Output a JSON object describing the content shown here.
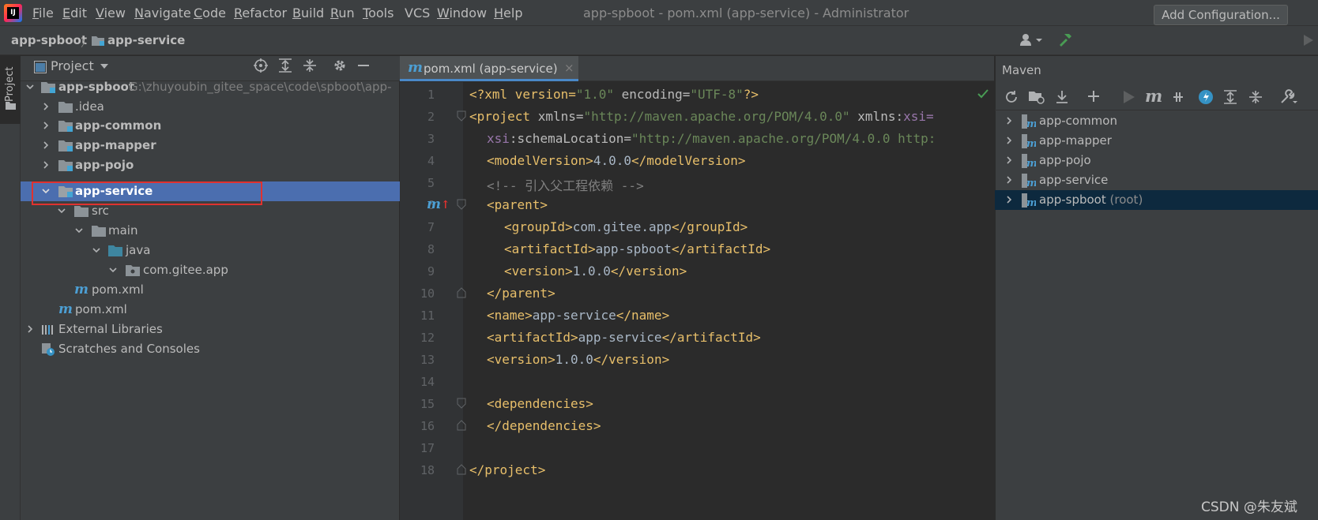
{
  "menubar": {
    "items": [
      {
        "label": "File",
        "mnemonic": "F",
        "rest": "ile"
      },
      {
        "label": "Edit",
        "mnemonic": "E",
        "rest": "dit"
      },
      {
        "label": "View",
        "mnemonic": "V",
        "rest": "iew"
      },
      {
        "label": "Navigate",
        "mnemonic": "N",
        "rest": "avigate"
      },
      {
        "label": "Code",
        "mnemonic": "C",
        "rest": "ode"
      },
      {
        "label": "Refactor",
        "mnemonic": "R",
        "rest": "efactor"
      },
      {
        "label": "Build",
        "mnemonic": "B",
        "rest": "uild"
      },
      {
        "label": "Run",
        "mnemonic": "R",
        "rest": "un"
      },
      {
        "label": "Tools",
        "mnemonic": "T",
        "rest": "ools"
      },
      {
        "label": "VCS",
        "mnemonic": "",
        "rest": "VCS"
      },
      {
        "label": "Window",
        "mnemonic": "W",
        "rest": "indow"
      },
      {
        "label": "Help",
        "mnemonic": "H",
        "rest": "elp"
      }
    ],
    "window_title": "app-spboot - pom.xml (app-service) - Administrator"
  },
  "navbar": {
    "breadcrumb": [
      "app-spboot",
      "app-service"
    ],
    "add_config_label": "Add Configuration..."
  },
  "left_strip": {
    "project_tab": "Project"
  },
  "project": {
    "title": "Project",
    "tree": [
      {
        "label": "app-spboot",
        "extra": "G:\\zhuyoubin_gitee_space\\code\\spboot\\app-",
        "bold": true,
        "expanded": true
      },
      {
        "label": ".idea",
        "bold": false,
        "expanded": false
      },
      {
        "label": "app-common",
        "bold": true,
        "expanded": false
      },
      {
        "label": "app-mapper",
        "bold": true,
        "expanded": false
      },
      {
        "label": "app-pojo",
        "bold": true,
        "expanded": false
      },
      {
        "label": "app-service",
        "bold": true,
        "expanded": true,
        "selected": true
      },
      {
        "label": "src",
        "bold": false,
        "expanded": true
      },
      {
        "label": "main",
        "bold": false,
        "expanded": true
      },
      {
        "label": "java",
        "bold": false,
        "expanded": true
      },
      {
        "label": "com.gitee.app",
        "bold": false,
        "expanded": true
      },
      {
        "label": "pom.xml",
        "bold": false
      },
      {
        "label": "pom.xml",
        "bold": false
      },
      {
        "label": "External Libraries",
        "bold": false,
        "expanded": false
      },
      {
        "label": "Scratches and Consoles",
        "bold": false
      }
    ]
  },
  "editor": {
    "tab_label": "pom.xml (app-service)",
    "line_numbers": [
      "1",
      "2",
      "3",
      "4",
      "5",
      "6",
      "7",
      "8",
      "9",
      "10",
      "11",
      "12",
      "13",
      "14",
      "15",
      "16",
      "17",
      "18"
    ],
    "lines": {
      "l1": {
        "p1": "<?xml version=",
        "p2": "\"1.0\"",
        "p3": " encoding=",
        "p4": "\"UTF-8\"",
        "p5": "?>"
      },
      "l2": {
        "p1": "<project",
        "p2": " xmlns=",
        "p3": "\"http://maven.apache.org/POM/4.0.0\"",
        "p4": " xmlns:",
        "p5": "xsi="
      },
      "l3": {
        "p1": "xsi",
        "p2": ":schemaLocation=",
        "p3": "\"http://maven.apache.org/POM/4.0.0 http:"
      },
      "l4": {
        "p1": "<modelVersion>",
        "p2": "4.0.0",
        "p3": "</modelVersion>"
      },
      "l5": {
        "p1": "<!-- 引入父工程依赖 -->"
      },
      "l6": {
        "p1": "<parent>"
      },
      "l7": {
        "p1": "<groupId>",
        "p2": "com.gitee.app",
        "p3": "</groupId>"
      },
      "l8": {
        "p1": "<artifactId>",
        "p2": "app-spboot",
        "p3": "</artifactId>"
      },
      "l9": {
        "p1": "<version>",
        "p2": "1.0.0",
        "p3": "</version>"
      },
      "l10": {
        "p1": "</parent>"
      },
      "l11": {
        "p1": "<name>",
        "p2": "app-service",
        "p3": "</name>"
      },
      "l12": {
        "p1": "<artifactId>",
        "p2": "app-service",
        "p3": "</artifactId>"
      },
      "l13": {
        "p1": "<version>",
        "p2": "1.0.0",
        "p3": "</version>"
      },
      "l15": {
        "p1": "<dependencies>"
      },
      "l16": {
        "p1": "</dependencies>"
      },
      "l18": {
        "p1": "</project>"
      }
    },
    "gutter_marker": "m"
  },
  "maven": {
    "title": "Maven",
    "projects": [
      {
        "label": "app-common",
        "suffix": ""
      },
      {
        "label": "app-mapper",
        "suffix": ""
      },
      {
        "label": "app-pojo",
        "suffix": ""
      },
      {
        "label": "app-service",
        "suffix": ""
      },
      {
        "label": "app-spboot",
        "suffix": " (root)"
      }
    ]
  },
  "watermark": "CSDN @朱友斌",
  "colors": {
    "selection": "#4b6eaf",
    "accent_red": "#e0322f",
    "tag": "#e8bf6a",
    "string": "#6a8759"
  }
}
